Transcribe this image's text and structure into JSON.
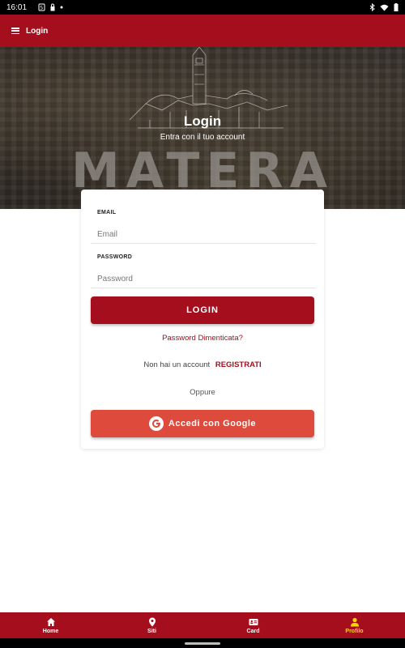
{
  "status_bar": {
    "time": "16:01"
  },
  "app_bar": {
    "title": "Login",
    "menu_icon": "hamburger-menu-icon"
  },
  "hero": {
    "title": "Login",
    "subtitle": "Entra con il tuo account",
    "watermark": "MATERA"
  },
  "form": {
    "email_label": "EMAIL",
    "email_placeholder": "Email",
    "email_value": "",
    "password_label": "PASSWORD",
    "password_placeholder": "Password",
    "password_value": "",
    "login_button": "LOGIN",
    "forgot_password": "Password Dimenticata?",
    "no_account_text": "Non hai un account",
    "register_link": "REGISTRATI",
    "or_text": "Oppure",
    "google_button": "Accedi con Google"
  },
  "bottom_nav": {
    "items": [
      {
        "label": "Home",
        "icon": "home-icon",
        "active": false
      },
      {
        "label": "Siti",
        "icon": "map-pin-icon",
        "active": false
      },
      {
        "label": "Card",
        "icon": "id-card-icon",
        "active": false
      },
      {
        "label": "Profilo",
        "icon": "person-icon",
        "active": true
      }
    ]
  },
  "colors": {
    "brand": "#a50f1d",
    "google": "#de4a3c",
    "active_nav": "#ffd400"
  }
}
